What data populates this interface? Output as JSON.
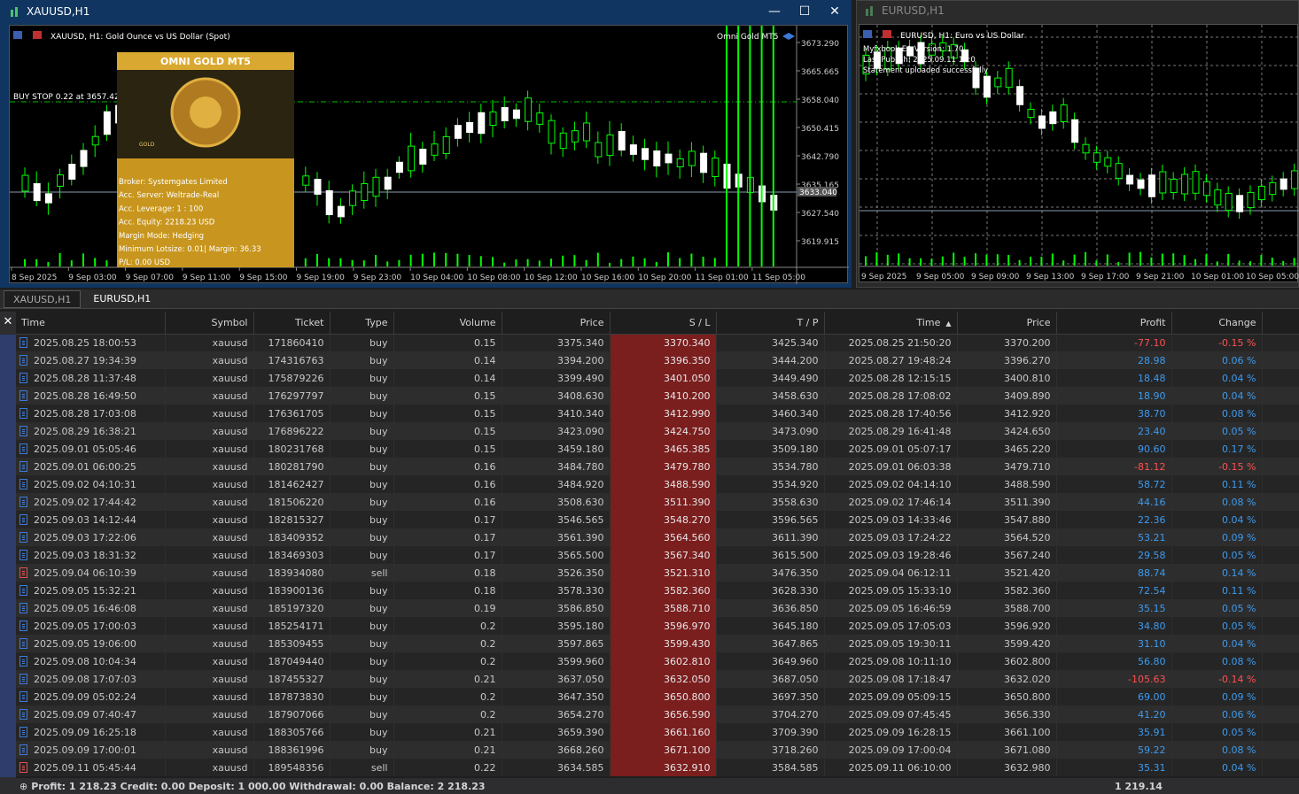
{
  "win1": {
    "title": "XAUUSD,H1",
    "chart_title": "XAUUSD, H1:  Gold Ounce vs US Dollar (Spot)",
    "ea_name": "Omni Gold MT5",
    "buy_stop": "BUY STOP 0.22 at 3657.42",
    "current_price": "3633.040",
    "y_labels": [
      "3673.290",
      "3665.665",
      "3658.040",
      "3650.415",
      "3642.790",
      "3635.165",
      "3627.540",
      "3619.915"
    ],
    "x_labels": [
      "8 Sep 2025",
      "9 Sep 03:00",
      "9 Sep 07:00",
      "9 Sep 11:00",
      "9 Sep 15:00",
      "9 Sep 19:00",
      "9 Sep 23:00",
      "10 Sep 04:00",
      "10 Sep 08:00",
      "10 Sep 12:00",
      "10 Sep 16:00",
      "10 Sep 20:00",
      "11 Sep 01:00",
      "11 Sep 05:00"
    ],
    "panel": {
      "header": "OMNI GOLD MT5",
      "logo_text": "GOLD",
      "lines": [
        "Broker:  Systemgates Limited",
        "Acc. Server:  Weltrade-Real",
        "Acc. Leverage:  1 : 100",
        "Acc. Equity:  2218.23 USD",
        "Margin Mode:  Hedging",
        "Minimum Lotsize: 0.01| Margin: 36.33",
        "P/L: 0.00 USD"
      ]
    }
  },
  "win2": {
    "title": "EURUSD,H1",
    "chart_title": "EURUSD, H1:  Euro vs US Dollar",
    "overlay": [
      "Myfxbook EA Version: 1.70",
      "Last Publish: 2025.09.11 11:0",
      "Statement uploaded successfully"
    ],
    "x_labels": [
      "9 Sep 2025",
      "9 Sep 05:00",
      "9 Sep 09:00",
      "9 Sep 13:00",
      "9 Sep 17:00",
      "9 Sep 21:00",
      "10 Sep 01:00",
      "10 Sep 05:00"
    ]
  },
  "tabs": [
    "XAUUSD,H1",
    "EURUSD,H1"
  ],
  "columns": [
    "Time",
    "Symbol",
    "Ticket",
    "Type",
    "Volume",
    "Price",
    "S / L",
    "T / P",
    "Time",
    "Price",
    "Profit",
    "Change"
  ],
  "sort_indicator": "▲",
  "rows": [
    [
      "2025.08.25 18:00:53",
      "xauusd",
      "171860410",
      "buy",
      "0.15",
      "3375.340",
      "3370.340",
      "3425.340",
      "2025.08.25 21:50:20",
      "3370.200",
      "-77.10",
      "-0.15 %"
    ],
    [
      "2025.08.27 19:34:39",
      "xauusd",
      "174316763",
      "buy",
      "0.14",
      "3394.200",
      "3396.350",
      "3444.200",
      "2025.08.27 19:48:24",
      "3396.270",
      "28.98",
      "0.06 %"
    ],
    [
      "2025.08.28 11:37:48",
      "xauusd",
      "175879226",
      "buy",
      "0.14",
      "3399.490",
      "3401.050",
      "3449.490",
      "2025.08.28 12:15:15",
      "3400.810",
      "18.48",
      "0.04 %"
    ],
    [
      "2025.08.28 16:49:50",
      "xauusd",
      "176297797",
      "buy",
      "0.15",
      "3408.630",
      "3410.200",
      "3458.630",
      "2025.08.28 17:08:02",
      "3409.890",
      "18.90",
      "0.04 %"
    ],
    [
      "2025.08.28 17:03:08",
      "xauusd",
      "176361705",
      "buy",
      "0.15",
      "3410.340",
      "3412.990",
      "3460.340",
      "2025.08.28 17:40:56",
      "3412.920",
      "38.70",
      "0.08 %"
    ],
    [
      "2025.08.29 16:38:21",
      "xauusd",
      "176896222",
      "buy",
      "0.15",
      "3423.090",
      "3424.750",
      "3473.090",
      "2025.08.29 16:41:48",
      "3424.650",
      "23.40",
      "0.05 %"
    ],
    [
      "2025.09.01 05:05:46",
      "xauusd",
      "180231768",
      "buy",
      "0.15",
      "3459.180",
      "3465.385",
      "3509.180",
      "2025.09.01 05:07:17",
      "3465.220",
      "90.60",
      "0.17 %"
    ],
    [
      "2025.09.01 06:00:25",
      "xauusd",
      "180281790",
      "buy",
      "0.16",
      "3484.780",
      "3479.780",
      "3534.780",
      "2025.09.01 06:03:38",
      "3479.710",
      "-81.12",
      "-0.15 %"
    ],
    [
      "2025.09.02 04:10:31",
      "xauusd",
      "181462427",
      "buy",
      "0.16",
      "3484.920",
      "3488.590",
      "3534.920",
      "2025.09.02 04:14:10",
      "3488.590",
      "58.72",
      "0.11 %"
    ],
    [
      "2025.09.02 17:44:42",
      "xauusd",
      "181506220",
      "buy",
      "0.16",
      "3508.630",
      "3511.390",
      "3558.630",
      "2025.09.02 17:46:14",
      "3511.390",
      "44.16",
      "0.08 %"
    ],
    [
      "2025.09.03 14:12:44",
      "xauusd",
      "182815327",
      "buy",
      "0.17",
      "3546.565",
      "3548.270",
      "3596.565",
      "2025.09.03 14:33:46",
      "3547.880",
      "22.36",
      "0.04 %"
    ],
    [
      "2025.09.03 17:22:06",
      "xauusd",
      "183409352",
      "buy",
      "0.17",
      "3561.390",
      "3564.560",
      "3611.390",
      "2025.09.03 17:24:22",
      "3564.520",
      "53.21",
      "0.09 %"
    ],
    [
      "2025.09.03 18:31:32",
      "xauusd",
      "183469303",
      "buy",
      "0.17",
      "3565.500",
      "3567.340",
      "3615.500",
      "2025.09.03 19:28:46",
      "3567.240",
      "29.58",
      "0.05 %"
    ],
    [
      "2025.09.04 06:10:39",
      "xauusd",
      "183934080",
      "sell",
      "0.18",
      "3526.350",
      "3521.310",
      "3476.350",
      "2025.09.04 06:12:11",
      "3521.420",
      "88.74",
      "0.14 %"
    ],
    [
      "2025.09.05 15:32:21",
      "xauusd",
      "183900136",
      "buy",
      "0.18",
      "3578.330",
      "3582.360",
      "3628.330",
      "2025.09.05 15:33:10",
      "3582.360",
      "72.54",
      "0.11 %"
    ],
    [
      "2025.09.05 16:46:08",
      "xauusd",
      "185197320",
      "buy",
      "0.19",
      "3586.850",
      "3588.710",
      "3636.850",
      "2025.09.05 16:46:59",
      "3588.700",
      "35.15",
      "0.05 %"
    ],
    [
      "2025.09.05 17:00:03",
      "xauusd",
      "185254171",
      "buy",
      "0.2",
      "3595.180",
      "3596.970",
      "3645.180",
      "2025.09.05 17:05:03",
      "3596.920",
      "34.80",
      "0.05 %"
    ],
    [
      "2025.09.05 19:06:00",
      "xauusd",
      "185309455",
      "buy",
      "0.2",
      "3597.865",
      "3599.430",
      "3647.865",
      "2025.09.05 19:30:11",
      "3599.420",
      "31.10",
      "0.04 %"
    ],
    [
      "2025.09.08 10:04:34",
      "xauusd",
      "187049440",
      "buy",
      "0.2",
      "3599.960",
      "3602.810",
      "3649.960",
      "2025.09.08 10:11:10",
      "3602.800",
      "56.80",
      "0.08 %"
    ],
    [
      "2025.09.08 17:07:03",
      "xauusd",
      "187455327",
      "buy",
      "0.21",
      "3637.050",
      "3632.050",
      "3687.050",
      "2025.09.08 17:18:47",
      "3632.020",
      "-105.63",
      "-0.14 %"
    ],
    [
      "2025.09.09 05:02:24",
      "xauusd",
      "187873830",
      "buy",
      "0.2",
      "3647.350",
      "3650.800",
      "3697.350",
      "2025.09.09 05:09:15",
      "3650.800",
      "69.00",
      "0.09 %"
    ],
    [
      "2025.09.09 07:40:47",
      "xauusd",
      "187907066",
      "buy",
      "0.2",
      "3654.270",
      "3656.590",
      "3704.270",
      "2025.09.09 07:45:45",
      "3656.330",
      "41.20",
      "0.06 %"
    ],
    [
      "2025.09.09 16:25:18",
      "xauusd",
      "188305766",
      "buy",
      "0.21",
      "3659.390",
      "3661.160",
      "3709.390",
      "2025.09.09 16:28:15",
      "3661.100",
      "35.91",
      "0.05 %"
    ],
    [
      "2025.09.09 17:00:01",
      "xauusd",
      "188361996",
      "buy",
      "0.21",
      "3668.260",
      "3671.100",
      "3718.260",
      "2025.09.09 17:00:04",
      "3671.080",
      "59.22",
      "0.08 %"
    ],
    [
      "2025.09.11 05:45:44",
      "xauusd",
      "189548356",
      "sell",
      "0.22",
      "3634.585",
      "3632.910",
      "3584.585",
      "2025.09.11 06:10:00",
      "3632.980",
      "35.31",
      "0.04 %"
    ]
  ],
  "footer": {
    "summary": "Profit: 1 218.23  Credit: 0.00  Deposit: 1 000.00  Withdrawal: 0.00  Balance: 2 218.23",
    "total": "1 219.14"
  },
  "colors": {
    "bull": "#00ff00",
    "bear": "#ffffff",
    "sl_bg": "#7b1e1e",
    "profit_pos": "#3c9bf0",
    "profit_neg": "#ff5050",
    "gold": "#c8961e"
  }
}
